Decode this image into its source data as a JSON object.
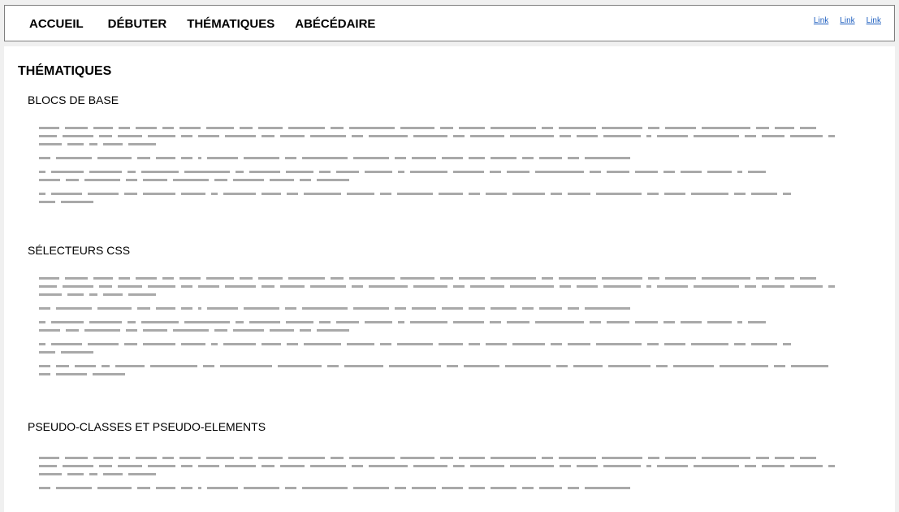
{
  "nav": {
    "items": [
      "ACCUEIL",
      "DÉBUTER",
      "THÉMATIQUES",
      "ABÉCÉDAIRE"
    ],
    "links": [
      "Link",
      "Link",
      "Link"
    ]
  },
  "main": {
    "page_title": "THÉMATIQUES",
    "sections": [
      {
        "heading": "BLOCS DE BASE"
      },
      {
        "heading": "SÉLECTEURS CSS"
      },
      {
        "heading": "PSEUDO-CLASSES ET PSEUDO-ELEMENTS"
      }
    ]
  },
  "colors": {
    "placeholder_text": "#a9a9a9",
    "link": "#1f5fbf",
    "border": "#7f7f7f",
    "background": "#f0f0f0"
  }
}
